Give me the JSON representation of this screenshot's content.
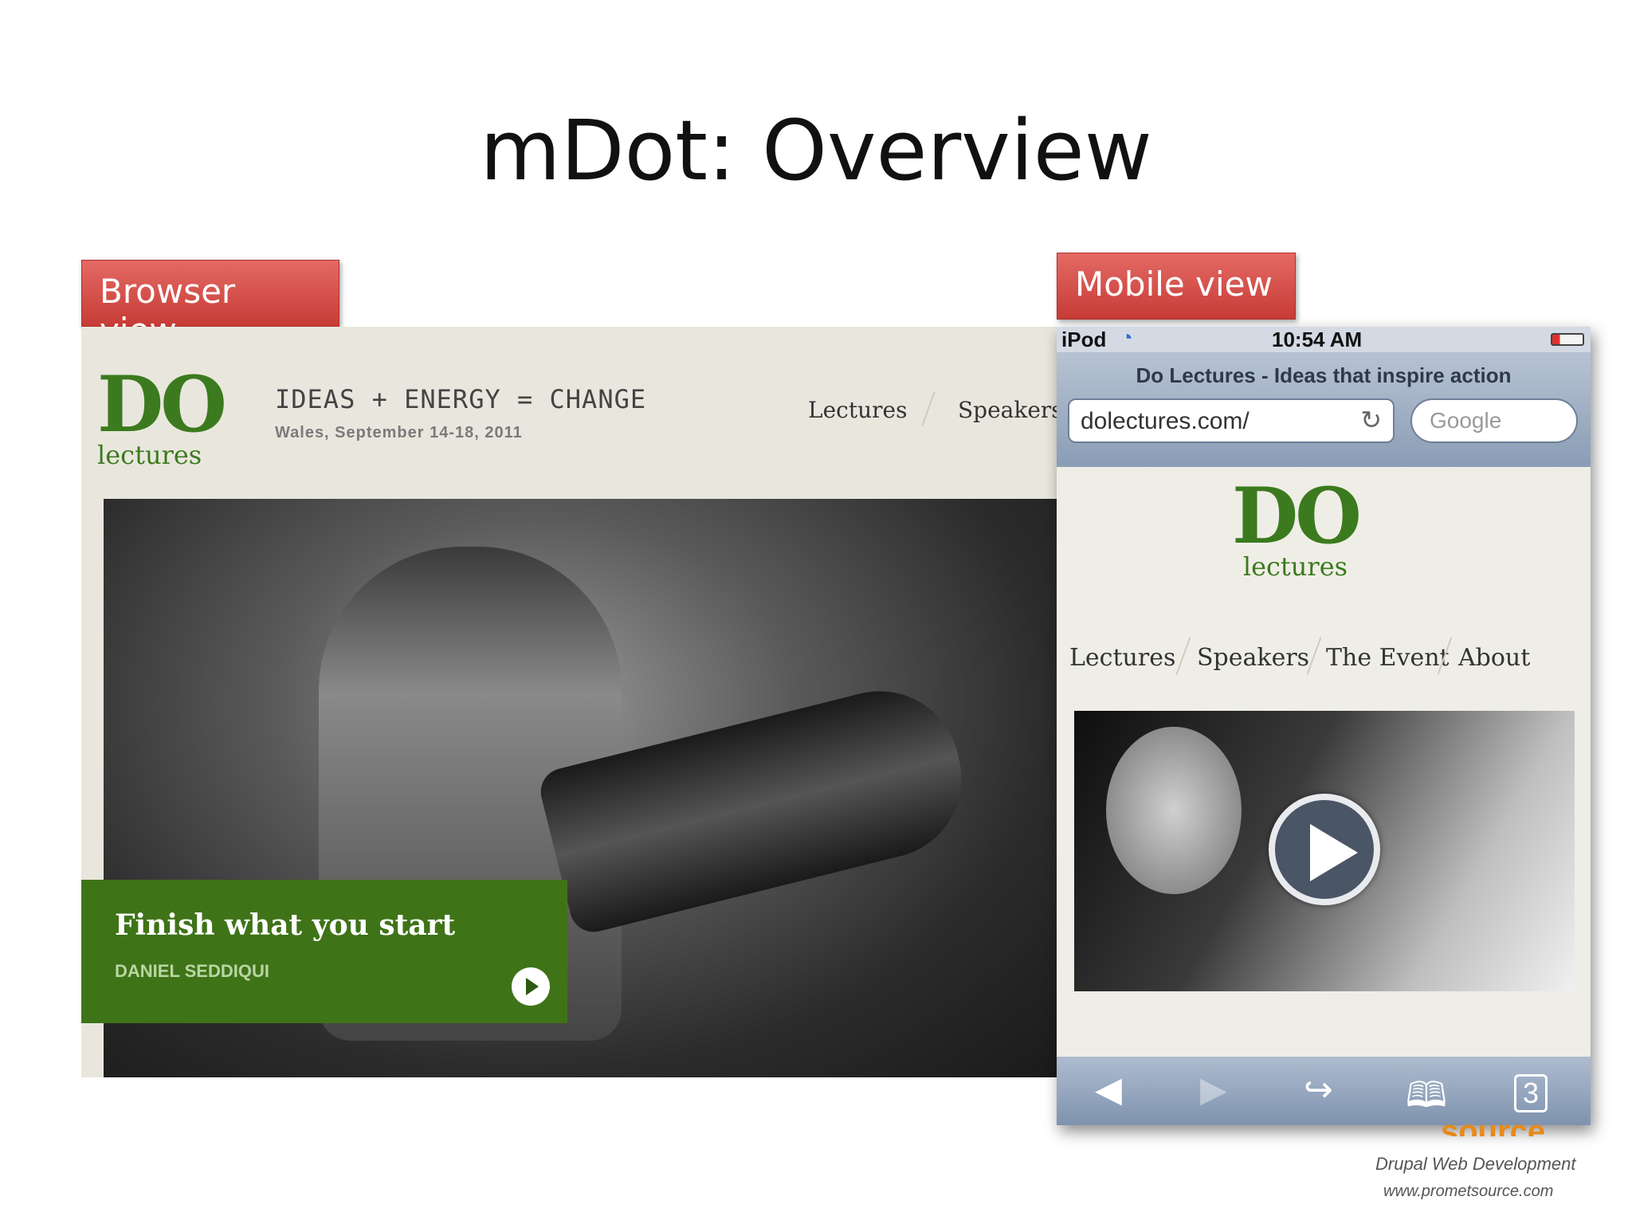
{
  "slide": {
    "title": "mDot: Overview"
  },
  "labels": {
    "browser": "Browser view",
    "mobile": "Mobile view"
  },
  "browser": {
    "logo": {
      "do": "DO",
      "lectures": "lectures"
    },
    "tagline": "IDEAS + ENERGY = CHANGE",
    "dates": "Wales, September 14-18, 2011",
    "nav": [
      "Lectures",
      "Speakers"
    ],
    "hero": {
      "headline": "Finish what you start",
      "speaker": "DANIEL SEDDIQUI"
    }
  },
  "mobile": {
    "status": {
      "carrier": "iPod",
      "time": "10:54 AM"
    },
    "page_title": "Do Lectures - Ideas that inspire action",
    "address": "dolectures.com/",
    "search_placeholder": "Google",
    "logo": {
      "do": "DO",
      "lectures": "lectures"
    },
    "nav": [
      "Lectures",
      "Speakers",
      "The Event",
      "About"
    ],
    "tabs_count": "3"
  },
  "footer": {
    "line1": "Drupal Web Development",
    "line2": "www.prometsource.com",
    "brand_fragment": "source"
  },
  "colors": {
    "accent_green": "#3f7318",
    "tag_red": "#d9534f"
  }
}
